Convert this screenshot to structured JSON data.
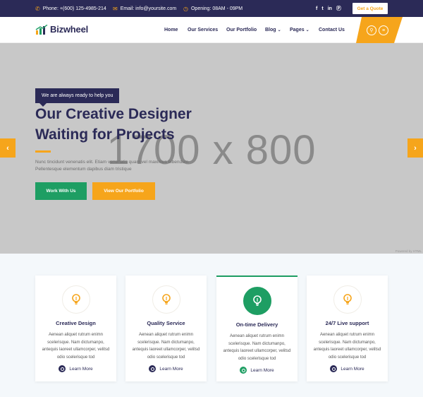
{
  "topbar": {
    "phone": "Phone: +(600) 125-4985-214",
    "email": "Email: info@yoursite.com",
    "opening": "Opening: 08AM - 09PM",
    "social_icons": [
      "facebook-icon",
      "twitter-icon",
      "linkedin-icon",
      "pinterest-icon"
    ],
    "quote_label": "Get a Quote"
  },
  "brand": {
    "name": "Bizwheel"
  },
  "nav": {
    "items": [
      {
        "label": "Home"
      },
      {
        "label": "Our Services"
      },
      {
        "label": "Our Portfolio"
      },
      {
        "label": "Blog",
        "has_dropdown": true
      },
      {
        "label": "Pages",
        "has_dropdown": true
      },
      {
        "label": "Contact Us"
      }
    ],
    "search_icon": "search-icon",
    "menu_icon": "menu-icon"
  },
  "hero": {
    "tagline": "We are always ready to help you",
    "title_line1": "Our Creative Designer",
    "title_line2": "Waiting for Projects",
    "description": "Nunc tincidunt venenatis elit. Etiam venenatis quam vel maximus bibendum Pellentesque elementum dapibus diam tristique",
    "primary_button": "Work With Us",
    "secondary_button": "View Our Portfolio",
    "placeholder_text": "1700 x 800",
    "powered_text": "Powered by HTML"
  },
  "services": {
    "cards": [
      {
        "title": "Creative Design",
        "text": "Aenean aliquet rutrum enimn scelerisque. Nam dictumanpo, antequis laoreet ullamcorper, velitsd odio scelerisque tod",
        "link": "Learn More",
        "active": false
      },
      {
        "title": "Quality Service",
        "text": "Aenean aliquet rutrum enimn scelerisque. Nam dictumanpo, antequis laoreet ullamcorper, velitsd odio scelerisque tod",
        "link": "Learn More",
        "active": false
      },
      {
        "title": "On-time Delivery",
        "text": "Aenean aliquet rutrum enimn scelerisque. Nam dictumanpo, antequis laoreet ullamcorper, velitsd odio scelerisque tod",
        "link": "Learn More",
        "active": true
      },
      {
        "title": "24/7 Live support",
        "text": "Aenean aliquet rutrum enimn scelerisque. Nam dictumanpo, antequis laoreet ullamcorper, velitsd odio scelerisque tod",
        "link": "Learn More",
        "active": false
      }
    ]
  },
  "colors": {
    "primary_navy": "#2b2a57",
    "accent_orange": "#f6a51b",
    "accent_green": "#1e9e63",
    "hero_placeholder": "#c8c8c8"
  }
}
